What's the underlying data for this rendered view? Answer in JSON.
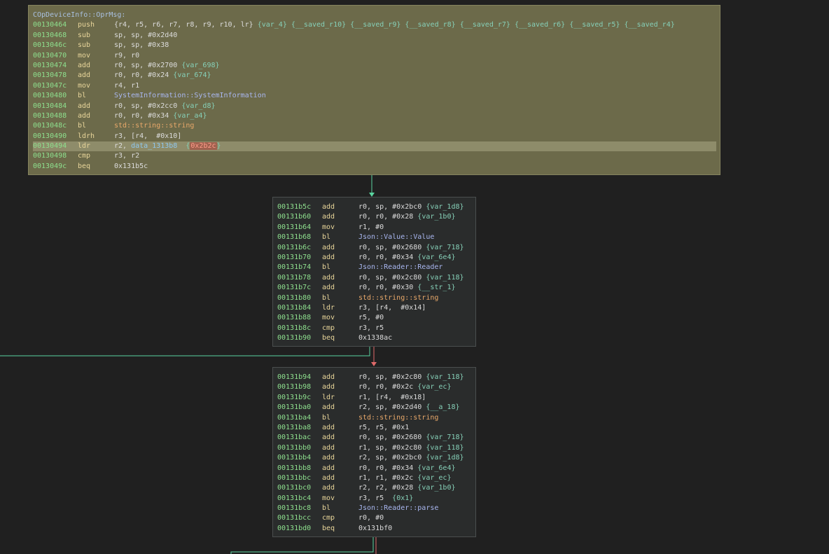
{
  "colors": {
    "background": "#202020",
    "block0_bg": "#6c6a4a",
    "block_bg": "#2a2c2c",
    "address": "#8ee08e",
    "mnemonic": "#e8d59a",
    "true_edge": "#5ad5a0",
    "false_edge": "#e06a6a"
  },
  "blocks": [
    {
      "title": "COpDeviceInfo::OprMsg:",
      "rows": [
        {
          "addr": "00130464",
          "mn": "push",
          "op": [
            {
              "t": "{r4, r5, r6, r7, r8, r9, r10, lr} ",
              "c": "op"
            },
            {
              "t": "{var_4} {__saved_r10} {__saved_r9} {__saved_r8} {__saved_r7} {__saved_r6} {__saved_r5} {__saved_r4}",
              "c": "ann"
            }
          ]
        },
        {
          "addr": "00130468",
          "mn": "sub",
          "op": [
            {
              "t": "sp, sp, #0x2d40",
              "c": "op"
            }
          ]
        },
        {
          "addr": "0013046c",
          "mn": "sub",
          "op": [
            {
              "t": "sp, sp, #0x38",
              "c": "op"
            }
          ]
        },
        {
          "addr": "00130470",
          "mn": "mov",
          "op": [
            {
              "t": "r9, r0",
              "c": "op"
            }
          ]
        },
        {
          "addr": "00130474",
          "mn": "add",
          "op": [
            {
              "t": "r0, sp, #0x2700 ",
              "c": "op"
            },
            {
              "t": "{var_698}",
              "c": "ann"
            }
          ]
        },
        {
          "addr": "00130478",
          "mn": "add",
          "op": [
            {
              "t": "r0, r0, #0x24 ",
              "c": "op"
            },
            {
              "t": "{var_674}",
              "c": "ann"
            }
          ]
        },
        {
          "addr": "0013047c",
          "mn": "mov",
          "op": [
            {
              "t": "r4, r1",
              "c": "op"
            }
          ]
        },
        {
          "addr": "00130480",
          "mn": "bl",
          "op": [
            {
              "t": "SystemInformation::SystemInformation",
              "c": "fn"
            }
          ]
        },
        {
          "addr": "00130484",
          "mn": "add",
          "op": [
            {
              "t": "r0, sp, #0x2cc0 ",
              "c": "op"
            },
            {
              "t": "{var_d8}",
              "c": "ann"
            }
          ]
        },
        {
          "addr": "00130488",
          "mn": "add",
          "op": [
            {
              "t": "r0, r0, #0x34 ",
              "c": "op"
            },
            {
              "t": "{var_a4}",
              "c": "ann"
            }
          ]
        },
        {
          "addr": "0013048c",
          "mn": "bl",
          "op": [
            {
              "t": "std::string::string",
              "c": "std"
            }
          ]
        },
        {
          "addr": "00130490",
          "mn": "ldrh",
          "op": [
            {
              "t": "r3, [r4,  #0x10]",
              "c": "op"
            }
          ]
        },
        {
          "addr": "00130494",
          "mn": "ldr",
          "hl": true,
          "op": [
            {
              "t": "r2, ",
              "c": "op"
            },
            {
              "t": "data_1313b8",
              "c": "dat"
            },
            {
              "t": "  {",
              "c": "ann"
            },
            {
              "t": "0x2b2c",
              "c": "hit"
            },
            {
              "t": "}",
              "c": "ann"
            }
          ]
        },
        {
          "addr": "00130498",
          "mn": "cmp",
          "op": [
            {
              "t": "r3, r2",
              "c": "op"
            }
          ]
        },
        {
          "addr": "0013049c",
          "mn": "beq",
          "op": [
            {
              "t": "0x131b5c",
              "c": "op"
            }
          ]
        }
      ]
    },
    {
      "title": "",
      "rows": [
        {
          "addr": "00131b5c",
          "mn": "add",
          "op": [
            {
              "t": "r0, sp, #0x2bc0 ",
              "c": "op"
            },
            {
              "t": "{var_1d8}",
              "c": "ann"
            }
          ]
        },
        {
          "addr": "00131b60",
          "mn": "add",
          "op": [
            {
              "t": "r0, r0, #0x28 ",
              "c": "op"
            },
            {
              "t": "{var_1b0}",
              "c": "ann"
            }
          ]
        },
        {
          "addr": "00131b64",
          "mn": "mov",
          "op": [
            {
              "t": "r1, #0",
              "c": "op"
            }
          ]
        },
        {
          "addr": "00131b68",
          "mn": "bl",
          "op": [
            {
              "t": "Json::Value::Value",
              "c": "fn"
            }
          ]
        },
        {
          "addr": "00131b6c",
          "mn": "add",
          "op": [
            {
              "t": "r0, sp, #0x2680 ",
              "c": "op"
            },
            {
              "t": "{var_718}",
              "c": "ann"
            }
          ]
        },
        {
          "addr": "00131b70",
          "mn": "add",
          "op": [
            {
              "t": "r0, r0, #0x34 ",
              "c": "op"
            },
            {
              "t": "{var_6e4}",
              "c": "ann"
            }
          ]
        },
        {
          "addr": "00131b74",
          "mn": "bl",
          "op": [
            {
              "t": "Json::Reader::Reader",
              "c": "fn"
            }
          ]
        },
        {
          "addr": "00131b78",
          "mn": "add",
          "op": [
            {
              "t": "r0, sp, #0x2c80 ",
              "c": "op"
            },
            {
              "t": "{var_118}",
              "c": "ann"
            }
          ]
        },
        {
          "addr": "00131b7c",
          "mn": "add",
          "op": [
            {
              "t": "r0, r0, #0x30 ",
              "c": "op"
            },
            {
              "t": "{__str_1}",
              "c": "ann"
            }
          ]
        },
        {
          "addr": "00131b80",
          "mn": "bl",
          "op": [
            {
              "t": "std::string::string",
              "c": "std"
            }
          ]
        },
        {
          "addr": "00131b84",
          "mn": "ldr",
          "op": [
            {
              "t": "r3, [r4,  #0x14]",
              "c": "op"
            }
          ]
        },
        {
          "addr": "00131b88",
          "mn": "mov",
          "op": [
            {
              "t": "r5, #0",
              "c": "op"
            }
          ]
        },
        {
          "addr": "00131b8c",
          "mn": "cmp",
          "op": [
            {
              "t": "r3, r5",
              "c": "op"
            }
          ]
        },
        {
          "addr": "00131b90",
          "mn": "beq",
          "op": [
            {
              "t": "0x1338ac",
              "c": "op"
            }
          ]
        }
      ]
    },
    {
      "title": "",
      "rows": [
        {
          "addr": "00131b94",
          "mn": "add",
          "op": [
            {
              "t": "r0, sp, #0x2c80 ",
              "c": "op"
            },
            {
              "t": "{var_118}",
              "c": "ann"
            }
          ]
        },
        {
          "addr": "00131b98",
          "mn": "add",
          "op": [
            {
              "t": "r0, r0, #0x2c ",
              "c": "op"
            },
            {
              "t": "{var_ec}",
              "c": "ann"
            }
          ]
        },
        {
          "addr": "00131b9c",
          "mn": "ldr",
          "op": [
            {
              "t": "r1, [r4,  #0x18]",
              "c": "op"
            }
          ]
        },
        {
          "addr": "00131ba0",
          "mn": "add",
          "op": [
            {
              "t": "r2, sp, #0x2d40 ",
              "c": "op"
            },
            {
              "t": "{__a_18}",
              "c": "ann"
            }
          ]
        },
        {
          "addr": "00131ba4",
          "mn": "bl",
          "op": [
            {
              "t": "std::string::string",
              "c": "std"
            }
          ]
        },
        {
          "addr": "00131ba8",
          "mn": "add",
          "op": [
            {
              "t": "r5, r5, #0x1",
              "c": "op"
            }
          ]
        },
        {
          "addr": "00131bac",
          "mn": "add",
          "op": [
            {
              "t": "r0, sp, #0x2680 ",
              "c": "op"
            },
            {
              "t": "{var_718}",
              "c": "ann"
            }
          ]
        },
        {
          "addr": "00131bb0",
          "mn": "add",
          "op": [
            {
              "t": "r1, sp, #0x2c80 ",
              "c": "op"
            },
            {
              "t": "{var_118}",
              "c": "ann"
            }
          ]
        },
        {
          "addr": "00131bb4",
          "mn": "add",
          "op": [
            {
              "t": "r2, sp, #0x2bc0 ",
              "c": "op"
            },
            {
              "t": "{var_1d8}",
              "c": "ann"
            }
          ]
        },
        {
          "addr": "00131bb8",
          "mn": "add",
          "op": [
            {
              "t": "r0, r0, #0x34 ",
              "c": "op"
            },
            {
              "t": "{var_6e4}",
              "c": "ann"
            }
          ]
        },
        {
          "addr": "00131bbc",
          "mn": "add",
          "op": [
            {
              "t": "r1, r1, #0x2c ",
              "c": "op"
            },
            {
              "t": "{var_ec}",
              "c": "ann"
            }
          ]
        },
        {
          "addr": "00131bc0",
          "mn": "add",
          "op": [
            {
              "t": "r2, r2, #0x28 ",
              "c": "op"
            },
            {
              "t": "{var_1b0}",
              "c": "ann"
            }
          ]
        },
        {
          "addr": "00131bc4",
          "mn": "mov",
          "op": [
            {
              "t": "r3, r5  ",
              "c": "op"
            },
            {
              "t": "{0x1}",
              "c": "ann"
            }
          ]
        },
        {
          "addr": "00131bc8",
          "mn": "bl",
          "op": [
            {
              "t": "Json::Reader::parse",
              "c": "fn"
            }
          ]
        },
        {
          "addr": "00131bcc",
          "mn": "cmp",
          "op": [
            {
              "t": "r0, #0",
              "c": "op"
            }
          ]
        },
        {
          "addr": "00131bd0",
          "mn": "beq",
          "op": [
            {
              "t": "0x131bf0",
              "c": "op"
            }
          ]
        }
      ]
    }
  ]
}
